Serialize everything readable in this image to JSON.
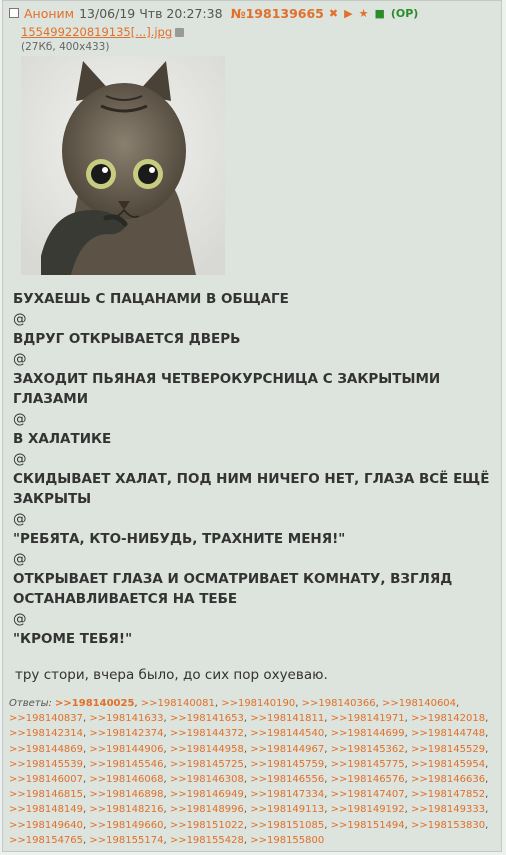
{
  "post": {
    "author": "Аноним",
    "date": "13/06/19 Чтв 20:27:38",
    "number": "№198139665",
    "op_badge": "(OP)",
    "icons": [
      "close-icon",
      "play-icon",
      "star-icon",
      "square-icon"
    ],
    "file": {
      "name": "155499220819135[...].jpg",
      "info": "(27Кб, 400x433)"
    },
    "greentext": [
      "БУХАЕШЬ С ПАЦАНАМИ В ОБЩАГЕ",
      "@",
      "ВДРУГ ОТКРЫВАЕТСЯ ДВЕРЬ",
      "@",
      "ЗАХОДИТ ПЬЯНАЯ ЧЕТВЕРОКУРСНИЦА С ЗАКРЫТЫМИ ГЛАЗАМИ",
      "@",
      "В ХАЛАТИКЕ",
      "@",
      "СКИДЫВАЕТ ХАЛАТ, ПОД НИМ НИЧЕГО НЕТ, ГЛАЗА ВСЁ ЕЩЁ ЗАКРЫТЫ",
      "@",
      "\"РЕБЯТА, КТО-НИБУДЬ, ТРАХНИТЕ МЕНЯ!\"",
      "@",
      "ОТКРЫВАЕТ ГЛАЗА И ОСМАТРИВАЕТ КОМНАТУ, ВЗГЛЯД ОСТАНАВЛИВАЕТСЯ НА ТЕБЕ",
      "@",
      "\"КРОМЕ ТЕБЯ!\""
    ],
    "comment": "тру стори, вчера было, до сих пор охуеваю.",
    "replies_label": "Ответы:",
    "replies": [
      ">>198140025",
      ">>198140081",
      ">>198140190",
      ">>198140366",
      ">>198140604",
      ">>198140837",
      ">>198141633",
      ">>198141653",
      ">>198141811",
      ">>198141971",
      ">>198142018",
      ">>198142314",
      ">>198142374",
      ">>198144372",
      ">>198144540",
      ">>198144699",
      ">>198144748",
      ">>198144869",
      ">>198144906",
      ">>198144958",
      ">>198144967",
      ">>198145362",
      ">>198145529",
      ">>198145539",
      ">>198145546",
      ">>198145725",
      ">>198145759",
      ">>198145775",
      ">>198145954",
      ">>198146007",
      ">>198146068",
      ">>198146308",
      ">>198146556",
      ">>198146576",
      ">>198146636",
      ">>198146815",
      ">>198146898",
      ">>198146949",
      ">>198147334",
      ">>198147407",
      ">>198147852",
      ">>198148149",
      ">>198148216",
      ">>198148996",
      ">>198149113",
      ">>198149192",
      ">>198149333",
      ">>198149640",
      ">>198149660",
      ">>198151022",
      ">>198151085",
      ">>198151494",
      ">>198153830",
      ">>198154765",
      ">>198155174",
      ">>198155428",
      ">>198155800"
    ]
  },
  "colors": {
    "accent": "#e0702a",
    "green": "#2a8c2a",
    "post_bg": "#dde3dd",
    "page_bg": "#eef2ee"
  }
}
